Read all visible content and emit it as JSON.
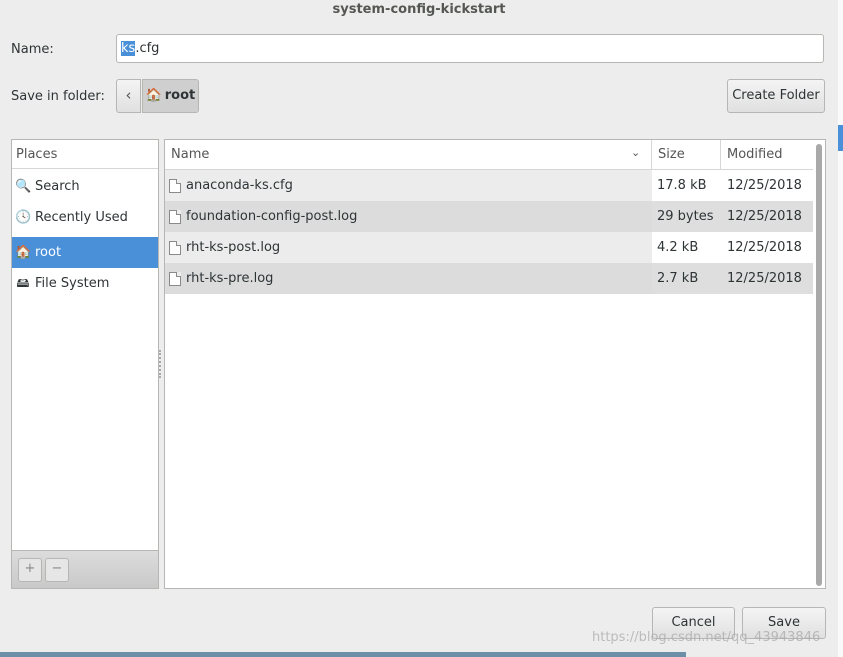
{
  "window": {
    "title": "system-config-kickstart"
  },
  "name_field": {
    "label": "Name:",
    "selected_part": "ks",
    "rest": ".cfg"
  },
  "folder": {
    "label": "Save in folder:",
    "back_glyph": "‹",
    "current": "root",
    "create_folder_label": "Create Folder"
  },
  "places": {
    "header": "Places",
    "items": [
      {
        "label": "Search",
        "icon": "search-icon",
        "glyph": "🔍"
      },
      {
        "label": "Recently Used",
        "icon": "recent-icon",
        "glyph": "🕓"
      },
      {
        "label": "root",
        "icon": "home-folder-icon",
        "glyph": "🏠",
        "active": true
      },
      {
        "label": "File System",
        "icon": "drive-icon",
        "glyph": "🖴"
      }
    ],
    "add_glyph": "+",
    "remove_glyph": "−"
  },
  "files": {
    "columns": {
      "name": "Name",
      "size": "Size",
      "modified": "Modified"
    },
    "sort_glyph": "⌄",
    "rows": [
      {
        "name": "anaconda-ks.cfg",
        "size": "17.8 kB",
        "modified": "12/25/2018"
      },
      {
        "name": "foundation-config-post.log",
        "size": "29 bytes",
        "modified": "12/25/2018"
      },
      {
        "name": "rht-ks-post.log",
        "size": "4.2 kB",
        "modified": "12/25/2018"
      },
      {
        "name": "rht-ks-pre.log",
        "size": "2.7 kB",
        "modified": "12/25/2018"
      }
    ]
  },
  "buttons": {
    "cancel": "Cancel",
    "save": "Save"
  },
  "watermark": "https://blog.csdn.net/qq_43943846",
  "colors": {
    "selection": "#4a90d9",
    "dialog_bg": "#ededed"
  }
}
